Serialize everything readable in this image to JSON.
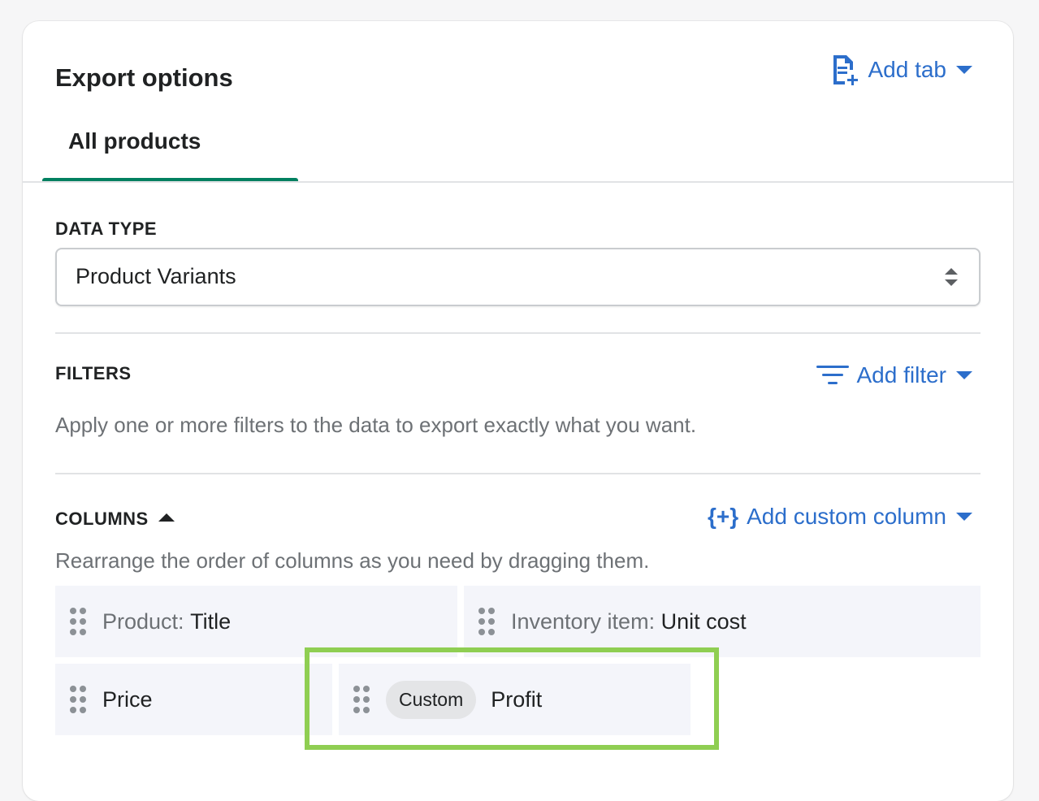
{
  "header": {
    "title": "Export options",
    "add_tab_label": "Add tab"
  },
  "tabs": [
    {
      "label": "All products",
      "selected": true
    }
  ],
  "data_type": {
    "label": "DATA TYPE",
    "selected_value": "Product Variants"
  },
  "filters": {
    "label": "FILTERS",
    "add_filter_label": "Add filter",
    "description": "Apply one or more filters to the data to export exactly what you want."
  },
  "columns": {
    "label": "COLUMNS",
    "add_custom_label": "Add custom column",
    "add_custom_icon": "{+}",
    "description": "Rearrange the order of columns as you need by dragging them.",
    "items": [
      {
        "prefix": "Product:",
        "name": "Title"
      },
      {
        "prefix": "Inventory item:",
        "name": "Unit cost"
      },
      {
        "prefix": "",
        "name": "Price"
      },
      {
        "badge": "Custom",
        "name": "Profit"
      }
    ]
  },
  "colors": {
    "accent_link": "#2c6ecb",
    "tab_underline": "#008060",
    "highlight_border": "#8fce52"
  }
}
